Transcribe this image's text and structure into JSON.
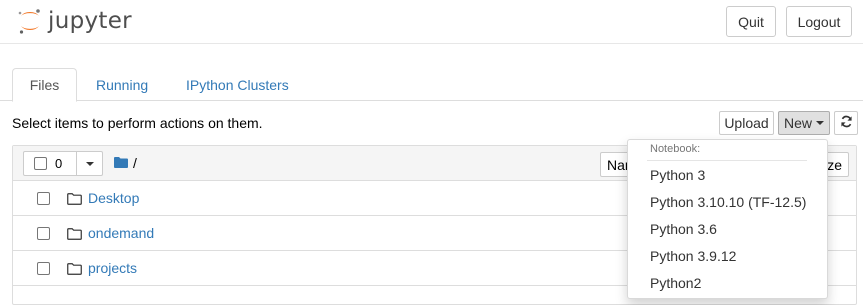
{
  "header": {
    "logo_text": "jupyter",
    "quit_label": "Quit",
    "logout_label": "Logout"
  },
  "tabs": [
    {
      "label": "Files",
      "active": true
    },
    {
      "label": "Running",
      "active": false
    },
    {
      "label": "IPython Clusters",
      "active": false
    }
  ],
  "toolbar": {
    "instructions": "Select items to perform actions on them.",
    "upload_label": "Upload",
    "new_label": "New"
  },
  "list": {
    "selected_count": "0",
    "breadcrumb": "/",
    "name_sort_label": "Name",
    "size_sort_label": "ze",
    "items": [
      {
        "name": "Desktop",
        "type": "folder"
      },
      {
        "name": "ondemand",
        "type": "folder"
      },
      {
        "name": "projects",
        "type": "folder"
      }
    ]
  },
  "new_menu": {
    "section_header": "Notebook:",
    "items": [
      "Python 3",
      "Python 3.10.10 (TF-12.5)",
      "Python 3.6",
      "Python 3.9.12",
      "Python2"
    ]
  },
  "colors": {
    "link": "#337ab7",
    "logo_orange": "#f37726",
    "folder_stroke": "#333333",
    "breadcrumb_folder": "#337ab7"
  },
  "icons": {
    "logo": "jupyter-logo-icon",
    "refresh": "refresh-icon",
    "breadcrumb": "folder-icon",
    "row": "folder-outline-icon"
  }
}
